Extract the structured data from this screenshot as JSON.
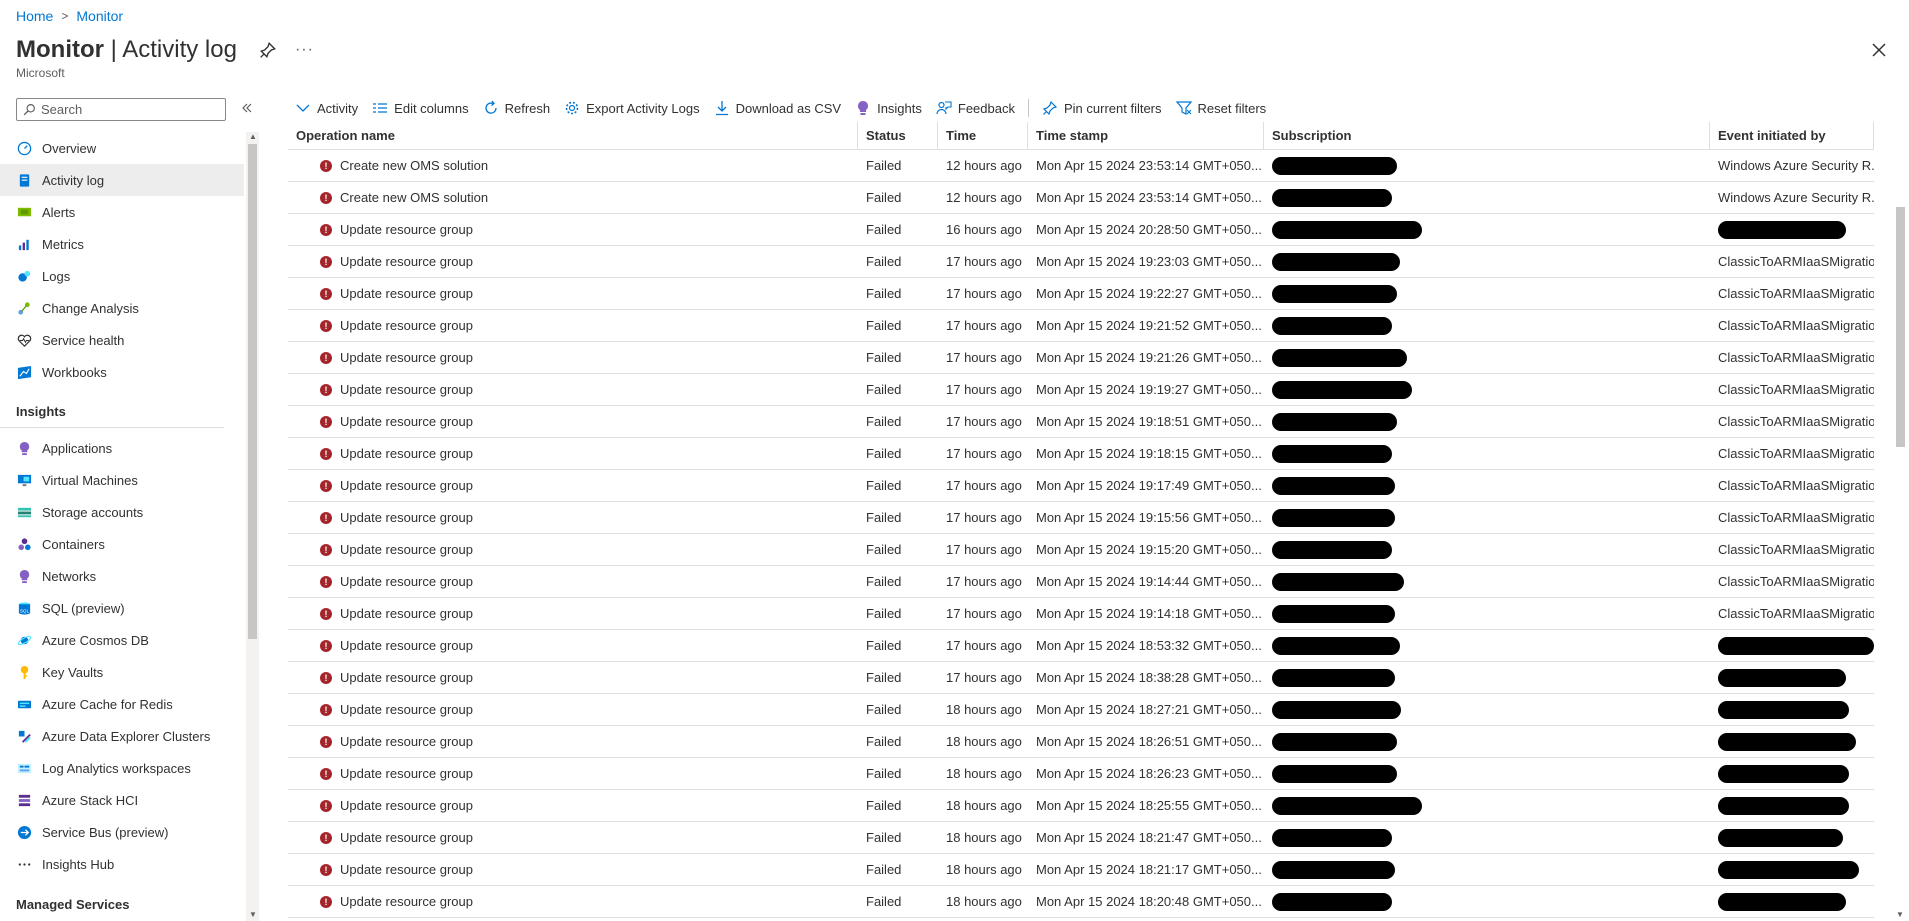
{
  "breadcrumb": {
    "home": "Home",
    "separator": ">",
    "current": "Monitor"
  },
  "header": {
    "title_bold": "Monitor",
    "title_rest": " | Activity log",
    "more": "···",
    "org": "Microsoft"
  },
  "search": {
    "placeholder": "Search",
    "collapse": "«"
  },
  "sidebar": {
    "top": [
      {
        "label": "Overview",
        "icon": "overview-icon",
        "active": false
      },
      {
        "label": "Activity log",
        "icon": "activity-log-icon",
        "active": true
      },
      {
        "label": "Alerts",
        "icon": "alerts-icon",
        "active": false
      },
      {
        "label": "Metrics",
        "icon": "metrics-icon",
        "active": false
      },
      {
        "label": "Logs",
        "icon": "logs-icon",
        "active": false
      },
      {
        "label": "Change Analysis",
        "icon": "change-analysis-icon",
        "active": false
      },
      {
        "label": "Service health",
        "icon": "service-health-icon",
        "active": false
      },
      {
        "label": "Workbooks",
        "icon": "workbooks-icon",
        "active": false
      }
    ],
    "insights_heading": "Insights",
    "insights": [
      {
        "label": "Applications",
        "icon": "applications-icon"
      },
      {
        "label": "Virtual Machines",
        "icon": "virtual-machines-icon"
      },
      {
        "label": "Storage accounts",
        "icon": "storage-accounts-icon"
      },
      {
        "label": "Containers",
        "icon": "containers-icon"
      },
      {
        "label": "Networks",
        "icon": "networks-icon"
      },
      {
        "label": "SQL (preview)",
        "icon": "sql-icon"
      },
      {
        "label": "Azure Cosmos DB",
        "icon": "cosmos-db-icon"
      },
      {
        "label": "Key Vaults",
        "icon": "key-vaults-icon"
      },
      {
        "label": "Azure Cache for Redis",
        "icon": "redis-icon"
      },
      {
        "label": "Azure Data Explorer Clusters",
        "icon": "data-explorer-icon"
      },
      {
        "label": "Log Analytics workspaces",
        "icon": "log-analytics-icon"
      },
      {
        "label": "Azure Stack HCI",
        "icon": "stack-hci-icon"
      },
      {
        "label": "Service Bus (preview)",
        "icon": "service-bus-icon"
      },
      {
        "label": "Insights Hub",
        "icon": "ellipsis-icon"
      }
    ],
    "managed_heading": "Managed Services"
  },
  "toolbar": [
    {
      "label": "Activity",
      "icon": "chevron-down-icon"
    },
    {
      "label": "Edit columns",
      "icon": "edit-columns-icon"
    },
    {
      "label": "Refresh",
      "icon": "refresh-icon"
    },
    {
      "label": "Export Activity Logs",
      "icon": "gear-icon"
    },
    {
      "label": "Download as CSV",
      "icon": "download-icon"
    },
    {
      "label": "Insights",
      "icon": "insights-bulb-icon"
    },
    {
      "label": "Feedback",
      "icon": "feedback-icon"
    },
    {
      "label": "Pin current filters",
      "icon": "pin-icon"
    },
    {
      "label": "Reset filters",
      "icon": "filter-icon"
    }
  ],
  "table": {
    "columns": [
      "Operation name",
      "Status",
      "Time",
      "Time stamp",
      "Subscription",
      "Event initiated by"
    ],
    "rows": [
      {
        "op": "Create new OMS solution",
        "status": "Failed",
        "time": "12 hours ago",
        "ts": "Mon Apr 15 2024 23:53:14 GMT+050...",
        "by": "Windows Azure Security R...",
        "sub_w": 0.63,
        "by_redact": false,
        "by_w": 0
      },
      {
        "op": "Create new OMS solution",
        "status": "Failed",
        "time": "12 hours ago",
        "ts": "Mon Apr 15 2024 23:53:14 GMT+050...",
        "by": "Windows Azure Security R...",
        "sub_w": 0.6,
        "by_redact": false,
        "by_w": 0
      },
      {
        "op": "Update resource group",
        "status": "Failed",
        "time": "16 hours ago",
        "ts": "Mon Apr 15 2024 20:28:50 GMT+050...",
        "by": "",
        "sub_w": 0.8,
        "by_redact": true,
        "by_w": 0.8
      },
      {
        "op": "Update resource group",
        "status": "Failed",
        "time": "17 hours ago",
        "ts": "Mon Apr 15 2024 19:23:03 GMT+050...",
        "by": "ClassicToARMIaaSMigration",
        "sub_w": 0.65,
        "by_redact": false,
        "by_w": 0
      },
      {
        "op": "Update resource group",
        "status": "Failed",
        "time": "17 hours ago",
        "ts": "Mon Apr 15 2024 19:22:27 GMT+050...",
        "by": "ClassicToARMIaaSMigration",
        "sub_w": 0.63,
        "by_redact": false,
        "by_w": 0
      },
      {
        "op": "Update resource group",
        "status": "Failed",
        "time": "17 hours ago",
        "ts": "Mon Apr 15 2024 19:21:52 GMT+050...",
        "by": "ClassicToARMIaaSMigration",
        "sub_w": 0.6,
        "by_redact": false,
        "by_w": 0
      },
      {
        "op": "Update resource group",
        "status": "Failed",
        "time": "17 hours ago",
        "ts": "Mon Apr 15 2024 19:21:26 GMT+050...",
        "by": "ClassicToARMIaaSMigration",
        "sub_w": 0.7,
        "by_redact": false,
        "by_w": 0
      },
      {
        "op": "Update resource group",
        "status": "Failed",
        "time": "17 hours ago",
        "ts": "Mon Apr 15 2024 19:19:27 GMT+050...",
        "by": "ClassicToARMIaaSMigration",
        "sub_w": 0.73,
        "by_redact": false,
        "by_w": 0
      },
      {
        "op": "Update resource group",
        "status": "Failed",
        "time": "17 hours ago",
        "ts": "Mon Apr 15 2024 19:18:51 GMT+050...",
        "by": "ClassicToARMIaaSMigration",
        "sub_w": 0.63,
        "by_redact": false,
        "by_w": 0
      },
      {
        "op": "Update resource group",
        "status": "Failed",
        "time": "17 hours ago",
        "ts": "Mon Apr 15 2024 19:18:15 GMT+050...",
        "by": "ClassicToARMIaaSMigration",
        "sub_w": 0.6,
        "by_redact": false,
        "by_w": 0
      },
      {
        "op": "Update resource group",
        "status": "Failed",
        "time": "17 hours ago",
        "ts": "Mon Apr 15 2024 19:17:49 GMT+050...",
        "by": "ClassicToARMIaaSMigration",
        "sub_w": 0.62,
        "by_redact": false,
        "by_w": 0
      },
      {
        "op": "Update resource group",
        "status": "Failed",
        "time": "17 hours ago",
        "ts": "Mon Apr 15 2024 19:15:56 GMT+050...",
        "by": "ClassicToARMIaaSMigration",
        "sub_w": 0.62,
        "by_redact": false,
        "by_w": 0
      },
      {
        "op": "Update resource group",
        "status": "Failed",
        "time": "17 hours ago",
        "ts": "Mon Apr 15 2024 19:15:20 GMT+050...",
        "by": "ClassicToARMIaaSMigration",
        "sub_w": 0.6,
        "by_redact": false,
        "by_w": 0
      },
      {
        "op": "Update resource group",
        "status": "Failed",
        "time": "17 hours ago",
        "ts": "Mon Apr 15 2024 19:14:44 GMT+050...",
        "by": "ClassicToARMIaaSMigration",
        "sub_w": 0.68,
        "by_redact": false,
        "by_w": 0
      },
      {
        "op": "Update resource group",
        "status": "Failed",
        "time": "17 hours ago",
        "ts": "Mon Apr 15 2024 19:14:18 GMT+050...",
        "by": "ClassicToARMIaaSMigration",
        "sub_w": 0.62,
        "by_redact": false,
        "by_w": 0
      },
      {
        "op": "Update resource group",
        "status": "Failed",
        "time": "17 hours ago",
        "ts": "Mon Apr 15 2024 18:53:32 GMT+050...",
        "by": "",
        "sub_w": 0.65,
        "by_redact": true,
        "by_w": 0.98
      },
      {
        "op": "Update resource group",
        "status": "Failed",
        "time": "17 hours ago",
        "ts": "Mon Apr 15 2024 18:38:28 GMT+050...",
        "by": "",
        "sub_w": 0.62,
        "by_redact": true,
        "by_w": 0.8
      },
      {
        "op": "Update resource group",
        "status": "Failed",
        "time": "18 hours ago",
        "ts": "Mon Apr 15 2024 18:27:21 GMT+050...",
        "by": "",
        "sub_w": 0.66,
        "by_redact": true,
        "by_w": 0.82
      },
      {
        "op": "Update resource group",
        "status": "Failed",
        "time": "18 hours ago",
        "ts": "Mon Apr 15 2024 18:26:51 GMT+050...",
        "by": "",
        "sub_w": 0.63,
        "by_redact": true,
        "by_w": 0.86
      },
      {
        "op": "Update resource group",
        "status": "Failed",
        "time": "18 hours ago",
        "ts": "Mon Apr 15 2024 18:26:23 GMT+050...",
        "by": "",
        "sub_w": 0.63,
        "by_redact": true,
        "by_w": 0.82
      },
      {
        "op": "Update resource group",
        "status": "Failed",
        "time": "18 hours ago",
        "ts": "Mon Apr 15 2024 18:25:55 GMT+050...",
        "by": "",
        "sub_w": 0.8,
        "by_redact": true,
        "by_w": 0.82
      },
      {
        "op": "Update resource group",
        "status": "Failed",
        "time": "18 hours ago",
        "ts": "Mon Apr 15 2024 18:21:47 GMT+050...",
        "by": "",
        "sub_w": 0.6,
        "by_redact": true,
        "by_w": 0.78
      },
      {
        "op": "Update resource group",
        "status": "Failed",
        "time": "18 hours ago",
        "ts": "Mon Apr 15 2024 18:21:17 GMT+050...",
        "by": "",
        "sub_w": 0.62,
        "by_redact": true,
        "by_w": 0.88
      },
      {
        "op": "Update resource group",
        "status": "Failed",
        "time": "18 hours ago",
        "ts": "Mon Apr 15 2024 18:20:48 GMT+050...",
        "by": "",
        "sub_w": 0.6,
        "by_redact": true,
        "by_w": 0.8
      }
    ]
  },
  "colors": {
    "accent": "#0078d4",
    "error": "#a4262c",
    "text": "#323130"
  }
}
